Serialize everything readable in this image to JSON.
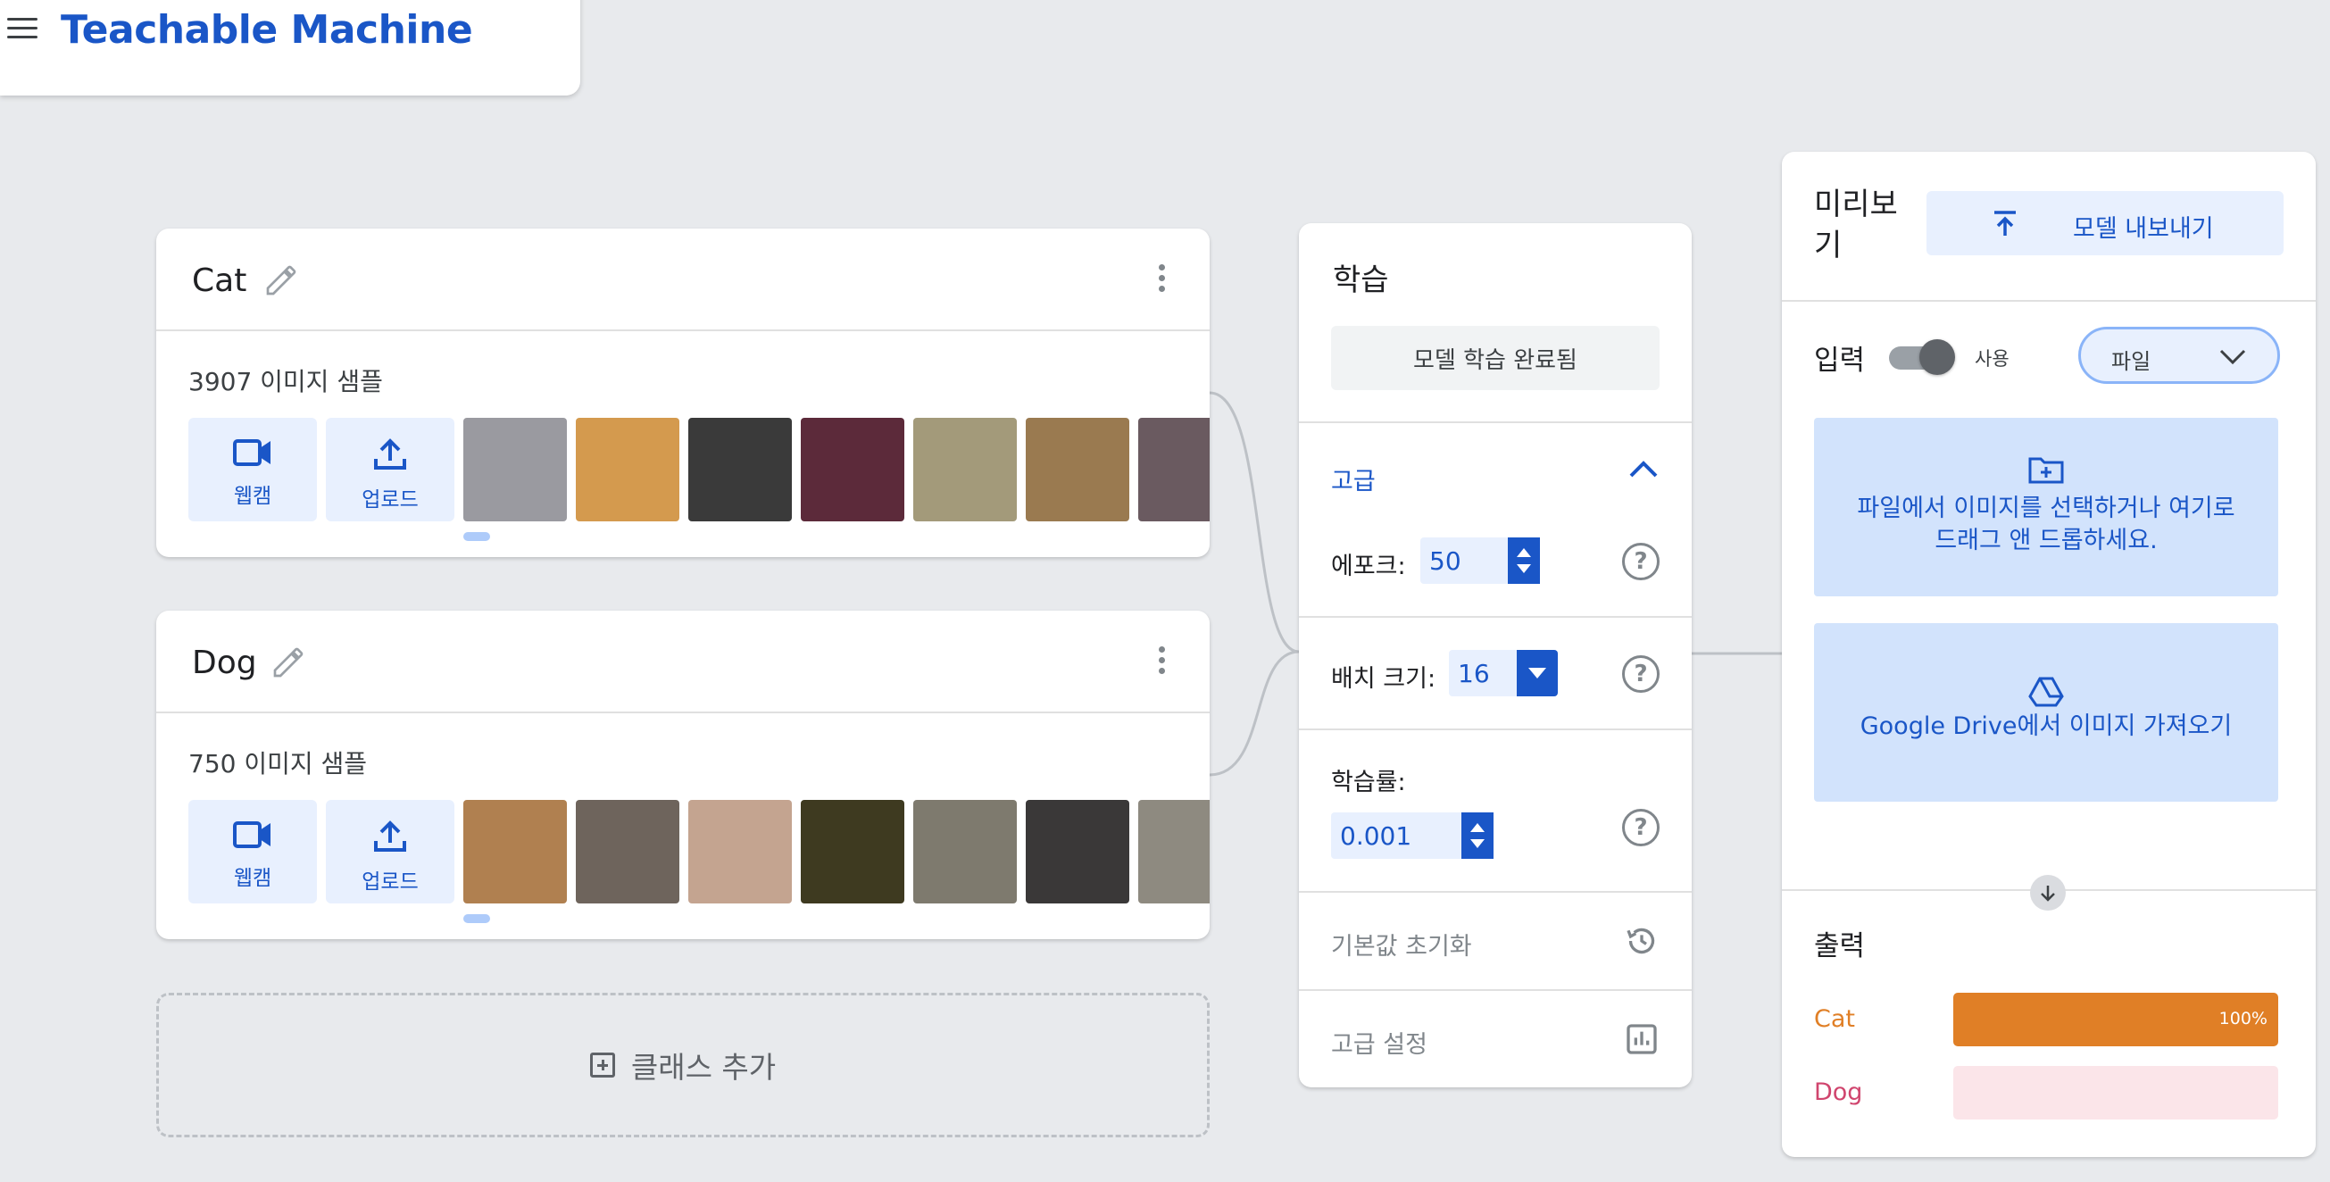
{
  "app": {
    "title": "Teachable Machine"
  },
  "classes": [
    {
      "name": "Cat",
      "sample_count": "3907 이미지 샘플",
      "webcam_label": "웹캠",
      "upload_label": "업로드",
      "thumb_colors": [
        "#9a9aa0",
        "#d49a4e",
        "#3a3a3a",
        "#5c2a3a",
        "#a39a7a",
        "#9a7a50",
        "#6a5a60"
      ]
    },
    {
      "name": "Dog",
      "sample_count": "750 이미지 샘플",
      "webcam_label": "웹캠",
      "upload_label": "업로드",
      "thumb_colors": [
        "#b08050",
        "#6e645c",
        "#c4a490",
        "#3e3a20",
        "#7e7a6e",
        "#3a3838",
        "#8e8a80"
      ]
    }
  ],
  "add_class_label": "클래스 추가",
  "training": {
    "title": "학습",
    "train_button": "모델 학습 완료됨",
    "advanced_label": "고급",
    "epochs_label": "에포크:",
    "epochs_value": "50",
    "batch_label": "배치 크기:",
    "batch_value": "16",
    "lr_label": "학습률:",
    "lr_value": "0.001",
    "reset_label": "기본값 초기화",
    "advanced_settings_label": "고급 설정",
    "help_glyph": "?"
  },
  "preview": {
    "title": "미리보기",
    "export_label": "모델 내보내기",
    "input_label": "입력",
    "toggle_label": "사용",
    "toggle_on": true,
    "source_value": "파일",
    "file_drop_text": "파일에서 이미지를 선택하거나 여기로 드래그 앤 드롭하세요.",
    "drive_text": "Google Drive에서 이미지 가져오기",
    "output_label": "출력",
    "outputs": [
      {
        "name": "Cat",
        "confidence": 1.0,
        "pct_text": "100%",
        "color": "#e07f26",
        "bg": "#e07f26"
      },
      {
        "name": "Dog",
        "confidence": 0.0,
        "pct_text": "",
        "color": "#d0456e",
        "bg": "#fbe5e9"
      }
    ]
  },
  "colors": {
    "accent": "#1a56c7",
    "panel_bg": "#ffffff",
    "page_bg": "#e8eaed"
  }
}
